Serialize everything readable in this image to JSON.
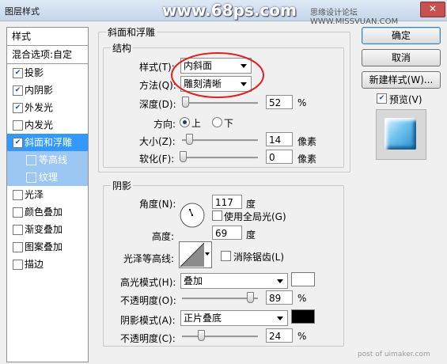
{
  "window": {
    "title": "图层样式",
    "watermark_main": "www.68ps.com",
    "watermark_side": "思缘设计论坛 WWW.MISSVUAN.COM",
    "close_label": "✕"
  },
  "sidebar": {
    "header": "样式",
    "blend": "混合选项:自定",
    "items": [
      {
        "label": "投影",
        "checked": true
      },
      {
        "label": "内阴影",
        "checked": true
      },
      {
        "label": "外发光",
        "checked": true
      },
      {
        "label": "内发光",
        "checked": false
      },
      {
        "label": "斜面和浮雕",
        "checked": true
      },
      {
        "label": "等高线",
        "checked": false
      },
      {
        "label": "纹理",
        "checked": false
      },
      {
        "label": "光泽",
        "checked": false
      },
      {
        "label": "颜色叠加",
        "checked": false
      },
      {
        "label": "渐变叠加",
        "checked": false
      },
      {
        "label": "图案叠加",
        "checked": false
      },
      {
        "label": "描边",
        "checked": false
      }
    ],
    "check_glyph": "✔"
  },
  "bevel": {
    "section_title": "斜面和浮雕",
    "structure_title": "结构",
    "style_label": "样式(T):",
    "style_value": "内斜面",
    "technique_label": "方法(Q):",
    "technique_value": "雕刻清晰",
    "depth_label": "深度(D):",
    "depth_value": "52",
    "percent": "%",
    "direction_label": "方向:",
    "dir_up": "上",
    "dir_down": "下",
    "size_label": "大小(Z):",
    "size_value": "14",
    "soften_label": "软化(F):",
    "soften_value": "0",
    "pixel_unit": "像素"
  },
  "shading": {
    "title": "阴影",
    "angle_label": "角度(N):",
    "angle_value": "117",
    "degree": "度",
    "global_light": "使用全局光(G)",
    "altitude_label": "高度:",
    "altitude_value": "69",
    "gloss_label": "光泽等高线:",
    "antialias": "消除锯齿(L)",
    "highlight_mode_label": "高光模式(H):",
    "highlight_mode_value": "叠加",
    "highlight_color": "#ffffff",
    "opacity_label": "不透明度(O):",
    "highlight_opacity": "89",
    "shadow_mode_label": "阴影模式(A):",
    "shadow_mode_value": "正片叠底",
    "shadow_color": "#000000",
    "opacity2_label": "不透明度(C):",
    "shadow_opacity": "24",
    "percent": "%"
  },
  "buttons": {
    "ok": "确定",
    "cancel": "取消",
    "new_style": "新建样式(W)...",
    "preview": "预览(V)"
  },
  "footer": {
    "watermark": "post of uimaker.com"
  },
  "annotation": {
    "color": "#e02020"
  }
}
